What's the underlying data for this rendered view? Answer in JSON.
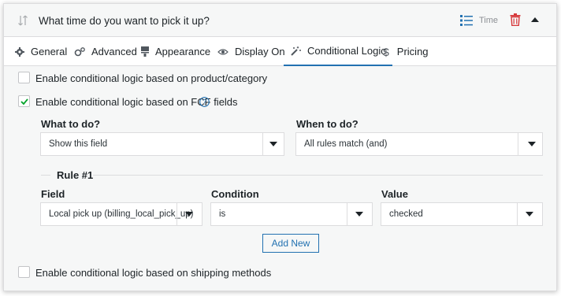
{
  "header": {
    "title": "What time do you want to pick it up?",
    "type_label": "Time"
  },
  "tabs": [
    {
      "label": "General",
      "icon": "gear-icon",
      "active": false
    },
    {
      "label": "Advanced",
      "icon": "gears-icon",
      "active": false
    },
    {
      "label": "Appearance",
      "icon": "brush-icon",
      "active": false
    },
    {
      "label": "Display On",
      "icon": "eye-icon",
      "active": false
    },
    {
      "label": "Conditional Logic",
      "icon": "magic-wand-icon",
      "active": true
    },
    {
      "label": "Pricing",
      "icon": "dollar-icon",
      "active": false
    }
  ],
  "options": {
    "product_category": {
      "label": "Enable conditional logic based on product/category",
      "checked": false
    },
    "fcf_fields": {
      "label": "Enable conditional logic based on FCF fields",
      "checked": true
    },
    "shipping_methods": {
      "label": "Enable conditional logic based on shipping methods",
      "checked": false
    }
  },
  "logic": {
    "what_label": "What to do?",
    "what_value": "Show this field",
    "when_label": "When to do?",
    "when_value": "All rules match (and)"
  },
  "rule": {
    "title": "Rule #1",
    "field_label": "Field",
    "field_value": "Local pick up (billing_local_pick_up)",
    "condition_label": "Condition",
    "condition_value": "is",
    "value_label": "Value",
    "value_value": "checked"
  },
  "add_new_label": "Add New",
  "colors": {
    "accent": "#2271b1",
    "check": "#00a32a",
    "delete": "#d63638"
  }
}
